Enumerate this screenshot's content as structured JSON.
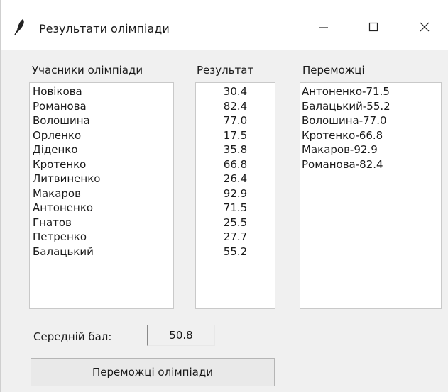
{
  "window": {
    "title": "Результати олімпіади",
    "icon": "feather-icon",
    "controls": [
      "minimize-icon",
      "maximize-icon",
      "close-icon"
    ]
  },
  "participants": {
    "header": "Учасники олімпіади",
    "items": [
      "Новікова",
      "Романова",
      "Волошина",
      "Орленко",
      "Діденко",
      "Кротенко",
      "Литвиненко",
      "Макаров",
      "Антоненко",
      "Гнатов",
      "Петренко",
      "Балацький"
    ]
  },
  "results": {
    "header": "Результат",
    "items": [
      "30.4",
      "82.4",
      "77.0",
      "17.5",
      "35.8",
      "66.8",
      "26.4",
      "92.9",
      "71.5",
      "25.5",
      "27.7",
      "55.2"
    ]
  },
  "winners": {
    "header": "Переможці",
    "items": [
      "Антоненко-71.5",
      "Балацький-55.2",
      "Волошина-77.0",
      "Кротенко-66.8",
      "Макаров-92.9",
      "Романова-82.4"
    ]
  },
  "average": {
    "label": "Середній бал:",
    "value": "50.8"
  },
  "actions": {
    "winners_button": "Переможці олімпіади"
  }
}
